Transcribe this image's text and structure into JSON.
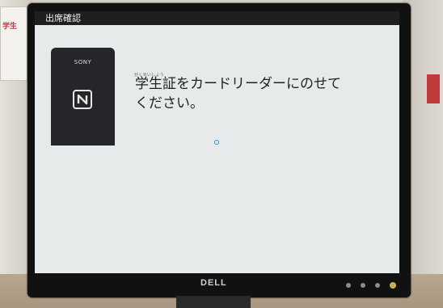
{
  "window": {
    "title": "出席確認"
  },
  "reader": {
    "brand": "SONY",
    "icon": "nfc-icon"
  },
  "prompt": {
    "furigana": "がくせいしょう",
    "line1": "学生証をカードリーダーにのせて",
    "line2": "ください。"
  },
  "monitor": {
    "brand": "DELL"
  },
  "background": {
    "poster_text": "学生"
  },
  "colors": {
    "spinner": "#2e8fdd",
    "titlebar": "#1f1f1f",
    "screen": "#e7eaeb"
  }
}
